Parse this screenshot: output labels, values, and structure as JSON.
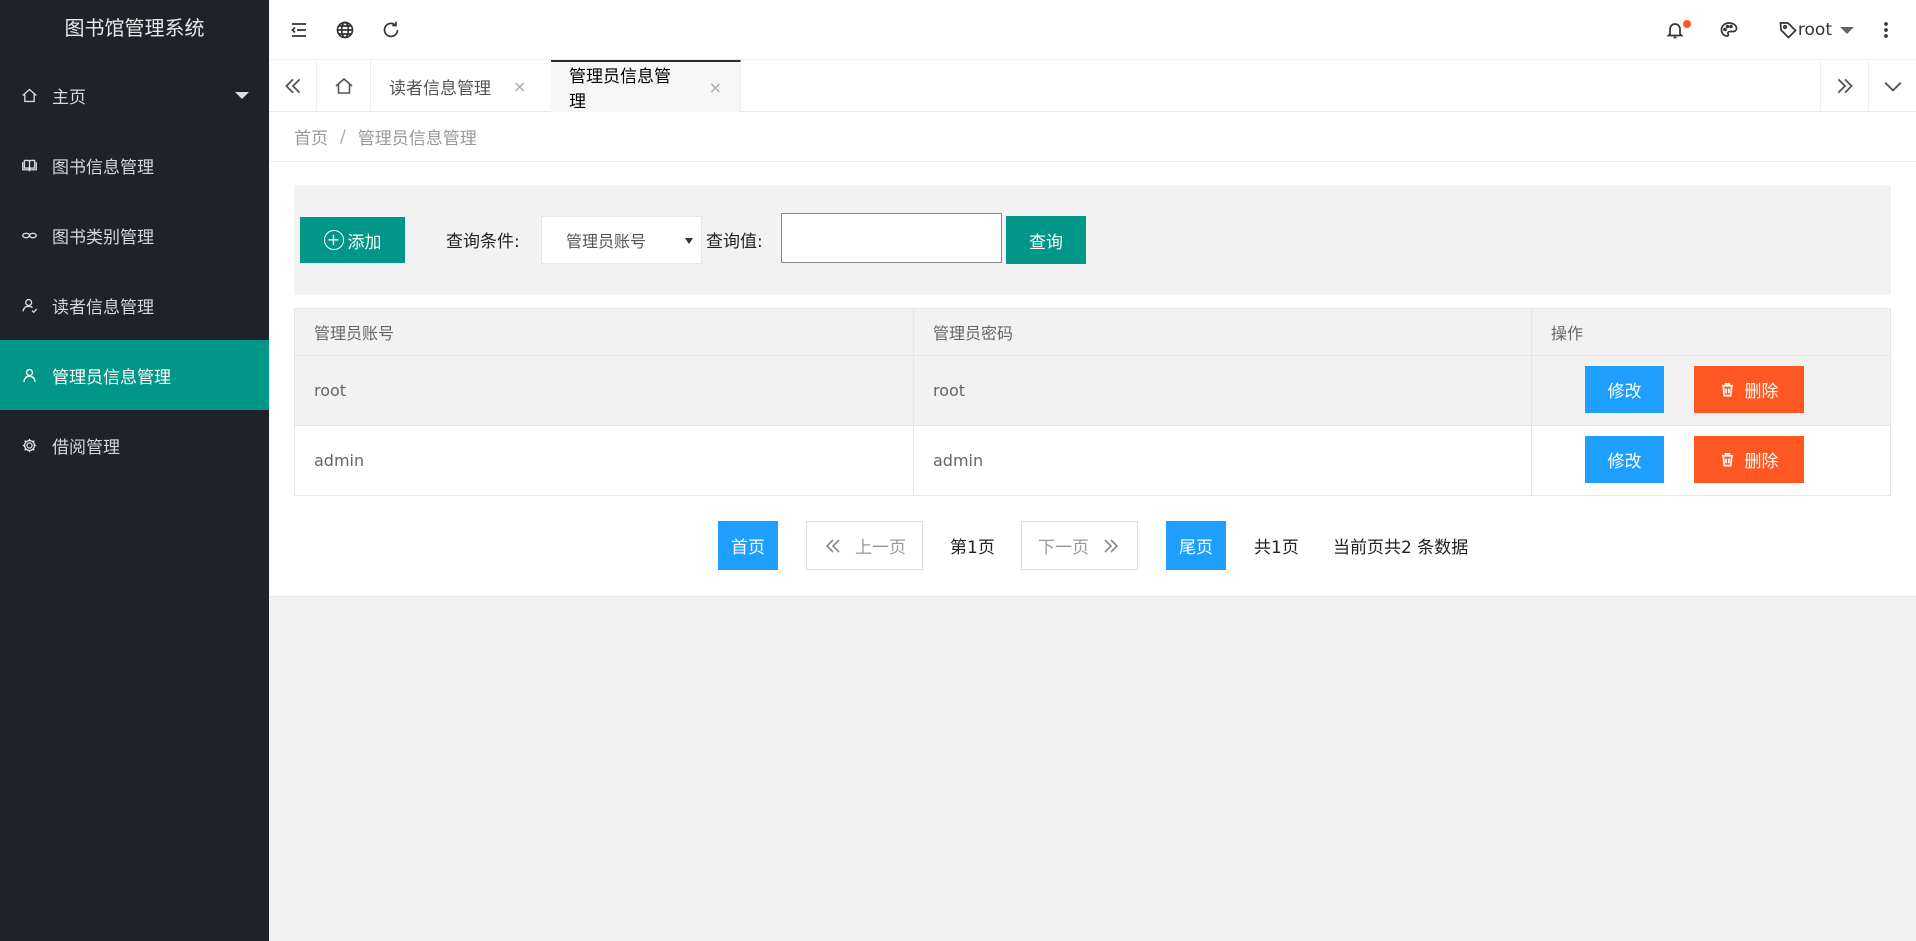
{
  "app": {
    "title": "图书馆管理系统"
  },
  "sidebar": {
    "items": [
      {
        "label": "主页",
        "icon": "home-icon"
      },
      {
        "label": "图书信息管理",
        "icon": "book-icon"
      },
      {
        "label": "图书类别管理",
        "icon": "link-icon"
      },
      {
        "label": "读者信息管理",
        "icon": "reader-icon"
      },
      {
        "label": "管理员信息管理",
        "icon": "user-icon"
      },
      {
        "label": "借阅管理",
        "icon": "gear-icon"
      }
    ]
  },
  "header": {
    "user": "root",
    "colors": {
      "notice_dot": "#ff5722"
    }
  },
  "tabs": {
    "items": [
      {
        "label": "读者信息管理"
      },
      {
        "label": "管理员信息管理"
      }
    ],
    "close_glyph": "×"
  },
  "breadcrumb": {
    "home": "首页",
    "separator": "/",
    "current": "管理员信息管理"
  },
  "toolbar": {
    "add_label": "添加",
    "condition_label": "查询条件:",
    "condition_value": "管理员账号",
    "value_label": "查询值:",
    "value_input": "",
    "query_label": "查询"
  },
  "table": {
    "headers": [
      "管理员账号",
      "管理员密码",
      "操作"
    ],
    "rows": [
      {
        "account": "root",
        "password": "root"
      },
      {
        "account": "admin",
        "password": "admin"
      }
    ],
    "edit_label": "修改",
    "delete_label": "删除"
  },
  "pagination": {
    "first": "首页",
    "prev": "上一页",
    "current": "第1页",
    "next": "下一页",
    "last": "尾页",
    "total_pages": "共1页",
    "summary": "当前页共2 条数据"
  },
  "colors": {
    "primary": "#009688",
    "blue": "#1e9fff",
    "danger": "#ff5722",
    "sidebar_bg": "#20222a"
  }
}
